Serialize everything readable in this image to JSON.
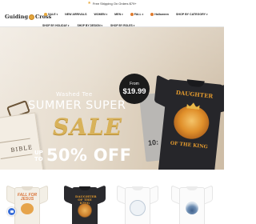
{
  "announcement": {
    "text": "Free Shipping On Orders $79+"
  },
  "header": {
    "logo_left": "Guiding",
    "logo_right": "Cross",
    "nav_primary": [
      {
        "label": "SALE",
        "dot_color": "#e9a93b"
      },
      {
        "label": "NEW ARRIVALS",
        "dot_color": null
      },
      {
        "label": "WOMEN",
        "dropdown": true
      },
      {
        "label": "MEN",
        "dropdown": true
      },
      {
        "label": "FALL",
        "dot_color": "#e07b2f",
        "dropdown": true
      },
      {
        "label": "Halloween",
        "dot_color": "#e07b2f"
      },
      {
        "label": "SHOP BY CATEGORY",
        "dropdown": true
      }
    ],
    "nav_secondary": [
      {
        "label": "SHOP BY HOLIDAY"
      },
      {
        "label": "SHOP BY DESIGN"
      },
      {
        "label": "SHOP BY ROLES"
      }
    ],
    "icons": [
      "search-icon",
      "account-icon",
      "cart-icon"
    ]
  },
  "hero": {
    "eyebrow": "Washed Tee",
    "headline": "SUMMER SUPER",
    "sale": "SALE",
    "up_to": "UP TO",
    "discount": "50% OFF",
    "badge_from": "From",
    "badge_price": "$19.99",
    "shirt_top": "DAUGHTER",
    "shirt_bottom": "OF THE KING",
    "grey_shirt_text": "10:",
    "book_text": "BIBLE",
    "colors": {
      "accent_gold": "#d8b25a",
      "badge": "#1b1b1b"
    }
  },
  "products": [
    {
      "style": "cream",
      "art_text": "FALL FOR JESUS"
    },
    {
      "style": "dark",
      "art_text": "DAUGHTER OF THE KING"
    },
    {
      "style": "white",
      "art_text": ""
    },
    {
      "style": "white",
      "art_text": ""
    }
  ]
}
